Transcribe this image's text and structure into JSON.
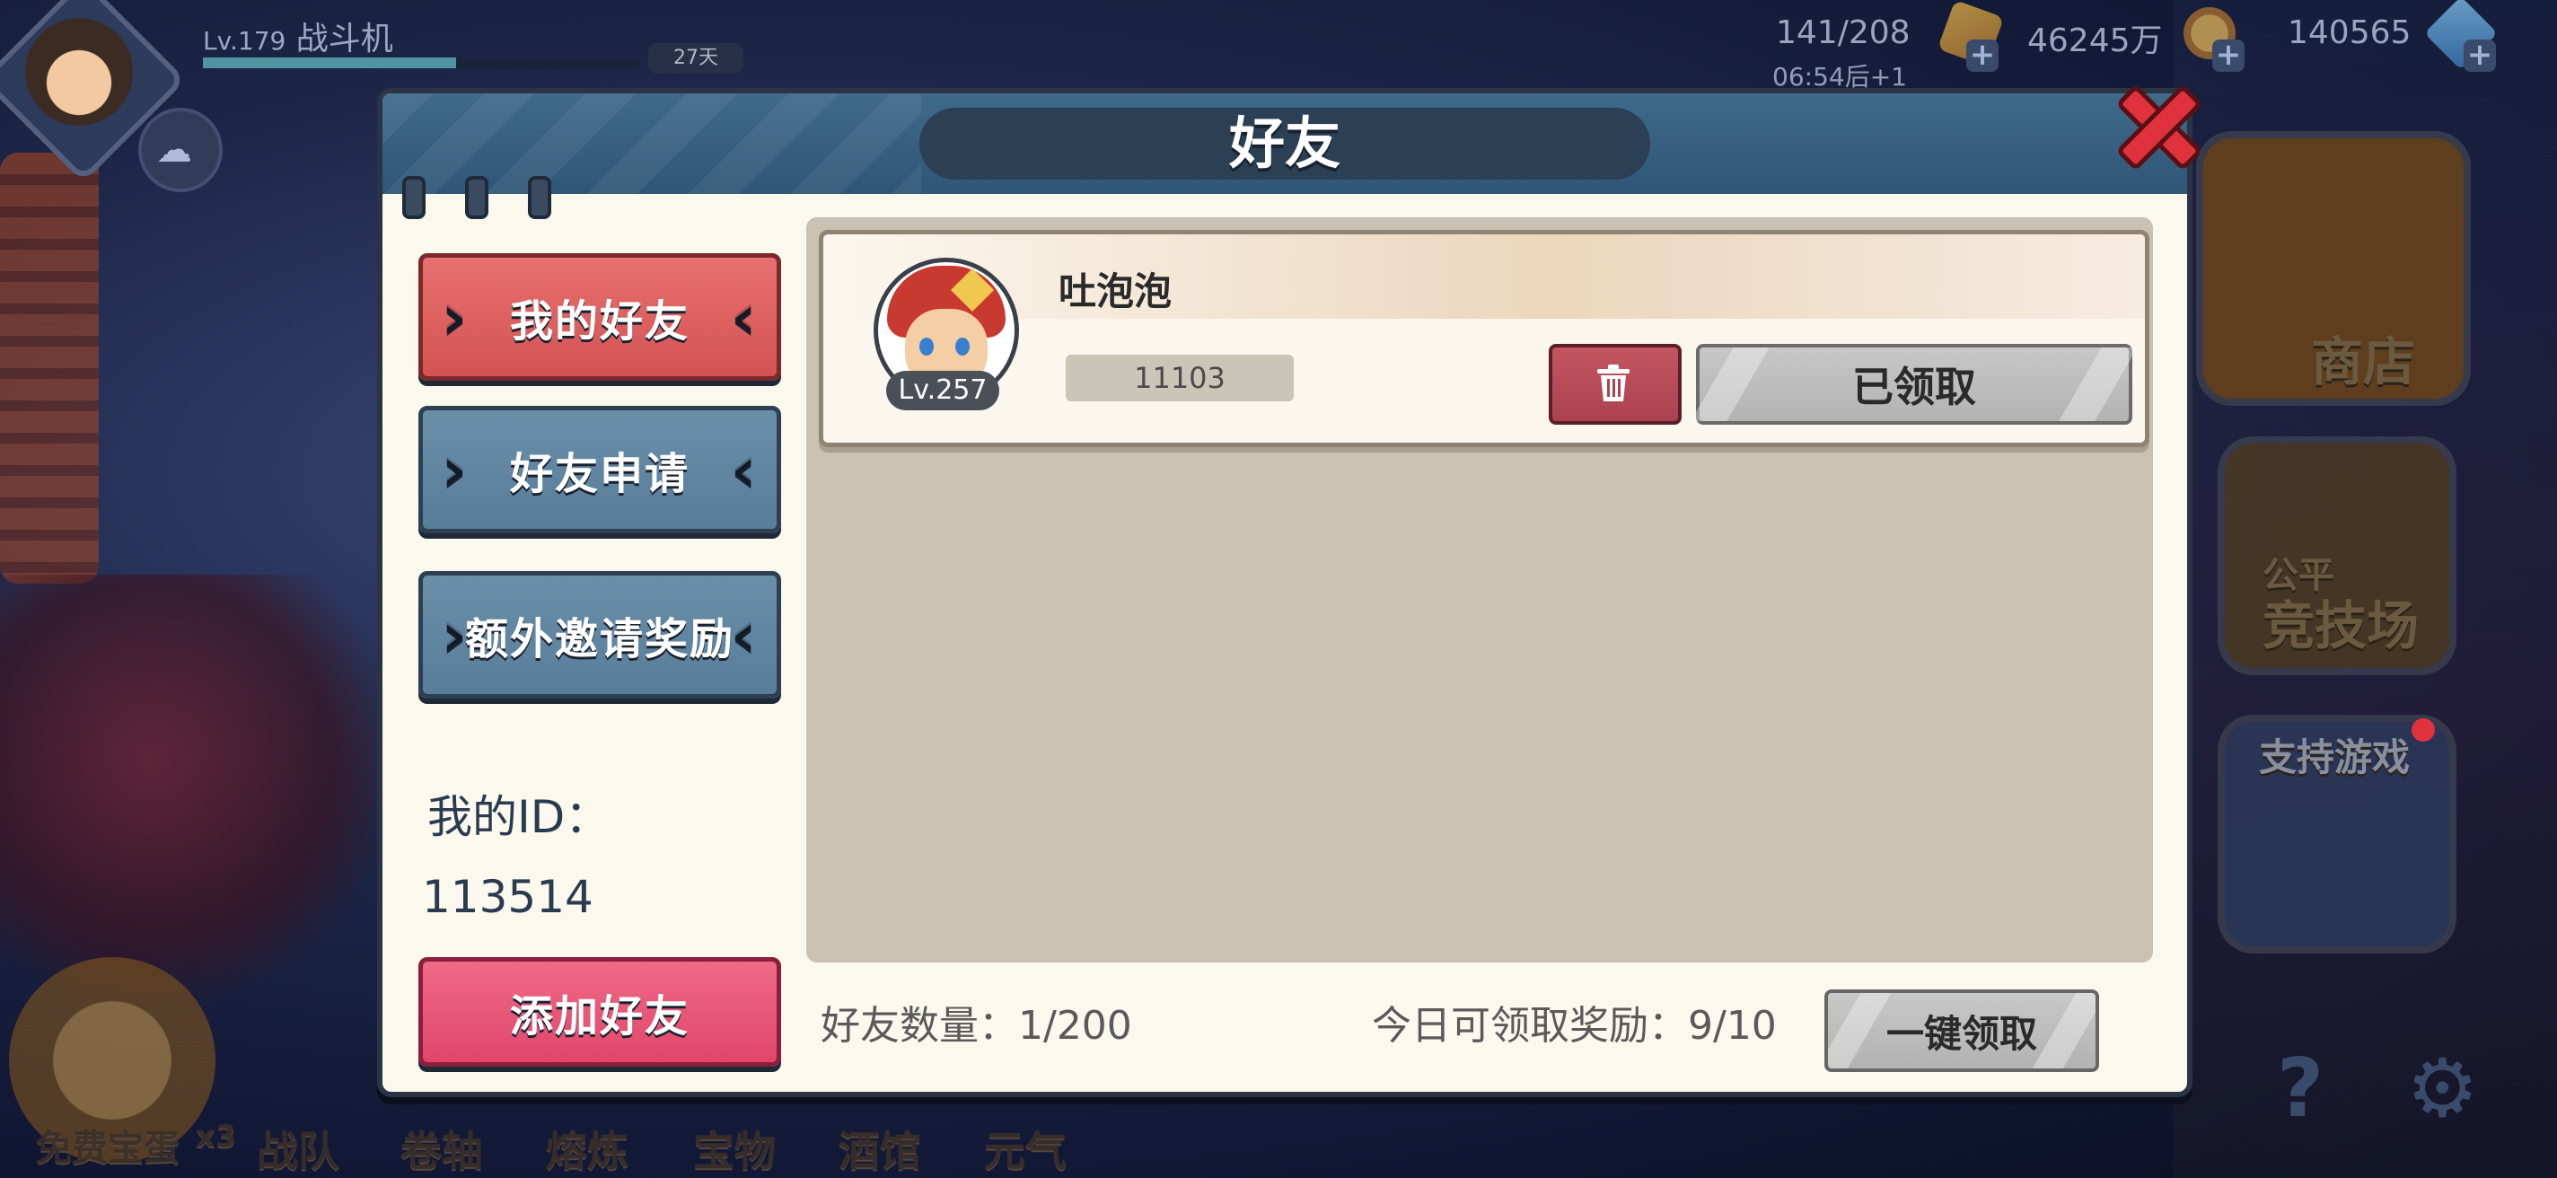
{
  "hud": {
    "level_prefix": "Lv.179",
    "player_name": "战斗机",
    "timer": "27天",
    "stamina": "141/208",
    "stamina_timer": "06:54后+1",
    "gold": "46245万",
    "gems": "140565"
  },
  "side_buttons": {
    "shop": "商店",
    "arena_top": "公平",
    "arena": "竞技场",
    "support": "支持游戏"
  },
  "bottom_bar": [
    "免费宝蛋",
    "x3",
    "战队",
    "卷轴",
    "熔炼",
    "宝物",
    "酒馆",
    "元气"
  ],
  "modal": {
    "title": "好友",
    "tabs": {
      "my_friends": "我的好友",
      "friend_requests": "好友申请",
      "extra_invite": "额外邀请奖励",
      "add_friend": "添加好友"
    },
    "my_id_label": "我的ID：",
    "my_id_value": "113514",
    "friends": [
      {
        "name": "吐泡泡",
        "level": "Lv.257",
        "id": "11103",
        "claim_label": "已领取"
      }
    ],
    "footer": {
      "friend_count": "好友数量：1/200",
      "daily_reward": "今日可领取奖励：9/10",
      "claim_all": "一键领取"
    }
  },
  "colors": {
    "tab_active": "#d25353",
    "tab_inactive": "#587d99",
    "add_friend": "#e0466a",
    "header": "#2f5676",
    "close": "#e0323d"
  }
}
